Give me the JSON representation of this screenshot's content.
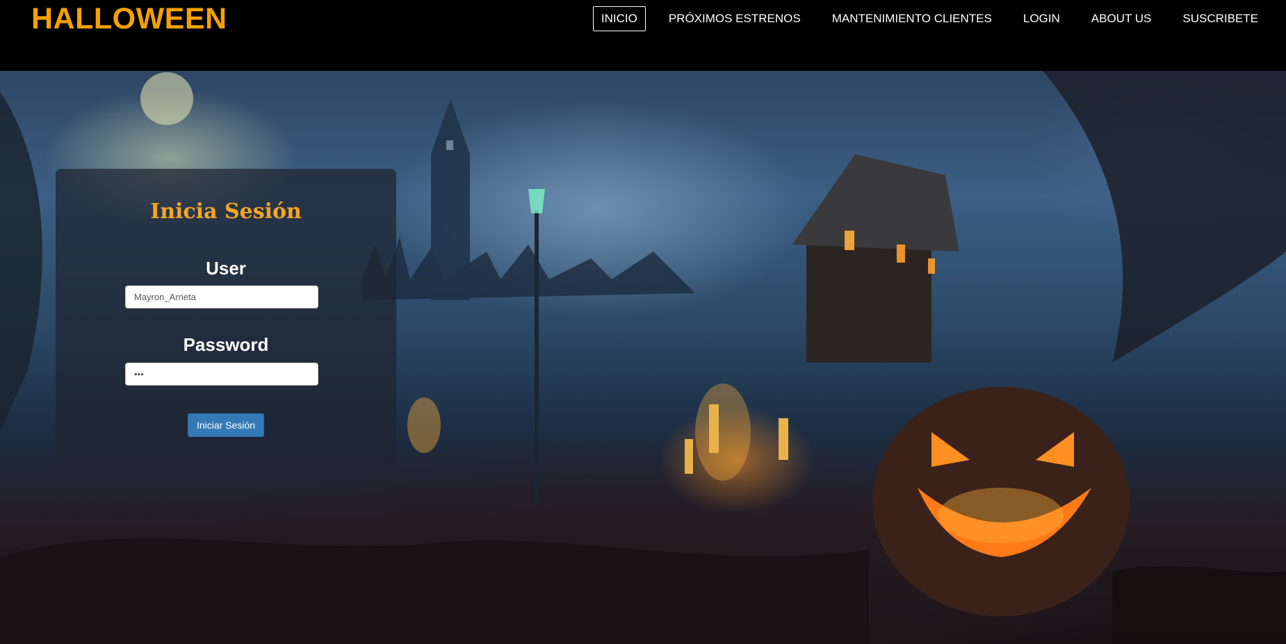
{
  "brand": {
    "title": "HALLOWEEN",
    "color": "#f5a100"
  },
  "nav": {
    "items": [
      {
        "label": "INICIO",
        "active": true
      },
      {
        "label": "PRÓXIMOS ESTRENOS",
        "active": false
      },
      {
        "label": "MANTENIMIENTO CLIENTES",
        "active": false
      },
      {
        "label": "LOGIN",
        "active": false
      },
      {
        "label": "ABOUT US",
        "active": false
      },
      {
        "label": "SUSCRIBETE",
        "active": false
      }
    ]
  },
  "hero": {
    "image": "halloween-haunted-house-scene"
  },
  "login": {
    "title": "Inicia Sesión",
    "title_color": "#f5a623",
    "user_label": "User",
    "user_value": "Mayron_Arrieta",
    "password_label": "Password",
    "password_value": "•••",
    "submit_label": "Iniciar Sesión",
    "button_color": "#337ab7"
  }
}
